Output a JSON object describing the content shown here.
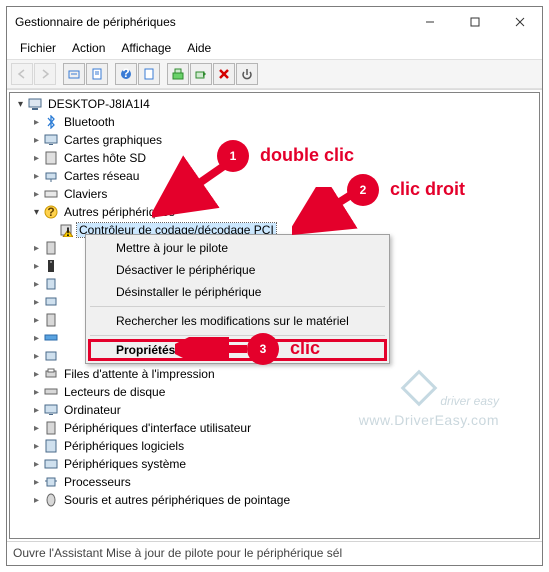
{
  "window": {
    "title": "Gestionnaire de périphériques"
  },
  "menubar": {
    "file": "Fichier",
    "action": "Action",
    "view": "Affichage",
    "help": "Aide"
  },
  "tree": {
    "root": "DESKTOP-J8IA1I4",
    "nodes": {
      "bluetooth": "Bluetooth",
      "display": "Cartes graphiques",
      "sdhost": "Cartes hôte SD",
      "network": "Cartes réseau",
      "keyboard": "Claviers",
      "other": "Autres périphériques",
      "pci": "Contrôleur de codage/décodage PCI",
      "printq": "Files d'attente à l'impression",
      "dvd": "Lecteurs de disque",
      "computer": "Ordinateur",
      "hid": "Périphériques d'interface utilisateur",
      "soft": "Périphériques logiciels",
      "system": "Périphériques système",
      "cpu": "Processeurs",
      "mouse": "Souris et autres périphériques de pointage"
    }
  },
  "context_menu": {
    "update": "Mettre à jour le pilote",
    "disable": "Désactiver le périphérique",
    "uninstall": "Désinstaller le périphérique",
    "scan": "Rechercher les modifications sur le matériel",
    "properties": "Propriétés"
  },
  "statusbar": {
    "text": "Ouvre l'Assistant Mise à jour de pilote pour le périphérique sél"
  },
  "annotations": {
    "step1": "1",
    "label1": "double  clic",
    "step2": "2",
    "label2": "clic droit",
    "step3": "3",
    "label3": "clic"
  },
  "watermark": {
    "brand": "driver easy",
    "url": "www.DriverEasy.com"
  }
}
